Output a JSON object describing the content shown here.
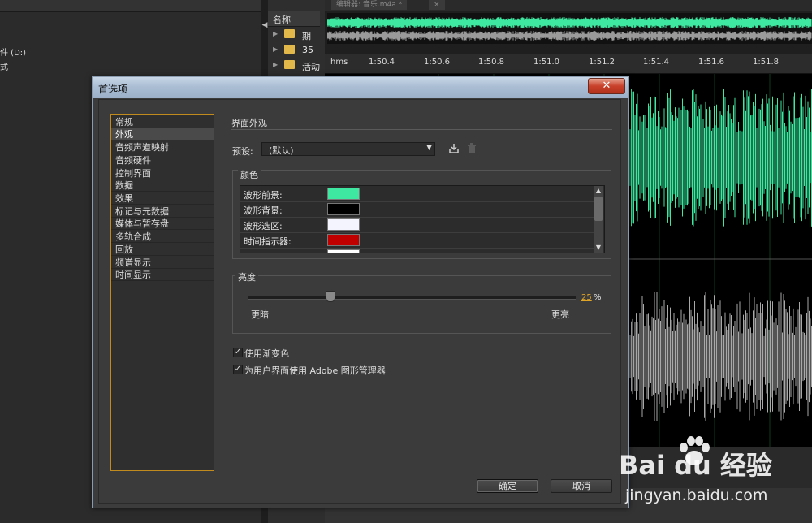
{
  "background": {
    "drive_text_1": "件 (D:)",
    "drive_text_2": "式",
    "files_header": "名称",
    "files": [
      {
        "name": "期"
      },
      {
        "name": "35"
      },
      {
        "name": "活动"
      }
    ],
    "editor_tabs": [
      "编辑器: 音乐.m4a *",
      "×"
    ],
    "ruler": {
      "unit": "hms",
      "ticks": [
        "1:50.4",
        "1:50.6",
        "1:50.8",
        "1:51.0",
        "1:51.2",
        "1:51.4",
        "1:51.6",
        "1:51.8"
      ]
    }
  },
  "dialog": {
    "title": "首选项",
    "close_label": "✕",
    "categories": [
      "常规",
      "外观",
      "音频声道映射",
      "音频硬件",
      "控制界面",
      "数据",
      "效果",
      "标记与元数据",
      "媒体与暂存盘",
      "多轨合成",
      "回放",
      "频谱显示",
      "时间显示"
    ],
    "selected_category": "外观",
    "section_title": "界面外观",
    "preset": {
      "label": "预设:",
      "value": "(默认)"
    },
    "colors": {
      "title": "颜色",
      "items": [
        {
          "name": "波形前景:",
          "color": "#3ee8a0"
        },
        {
          "name": "波形背景:",
          "color": "#000000"
        },
        {
          "name": "波形选区:",
          "color": "#f4f4ff"
        },
        {
          "name": "时间指示器:",
          "color": "#c00000"
        }
      ]
    },
    "brightness": {
      "title": "亮度",
      "value": "25",
      "unit": "%",
      "level_fraction": 0.25,
      "darker": "更暗",
      "brighter": "更亮"
    },
    "options": [
      {
        "label": "使用渐变色",
        "checked": true
      },
      {
        "label": "为用户界面使用 Adobe 图形管理器",
        "checked": true
      }
    ],
    "ok_label": "确定",
    "cancel_label": "取消"
  },
  "watermark": {
    "logo": "Bai  du 经验",
    "url": "jingyan.baidu.com"
  },
  "theme": {
    "accent": "#c28b1e",
    "waveform": "#3ee8a0"
  }
}
